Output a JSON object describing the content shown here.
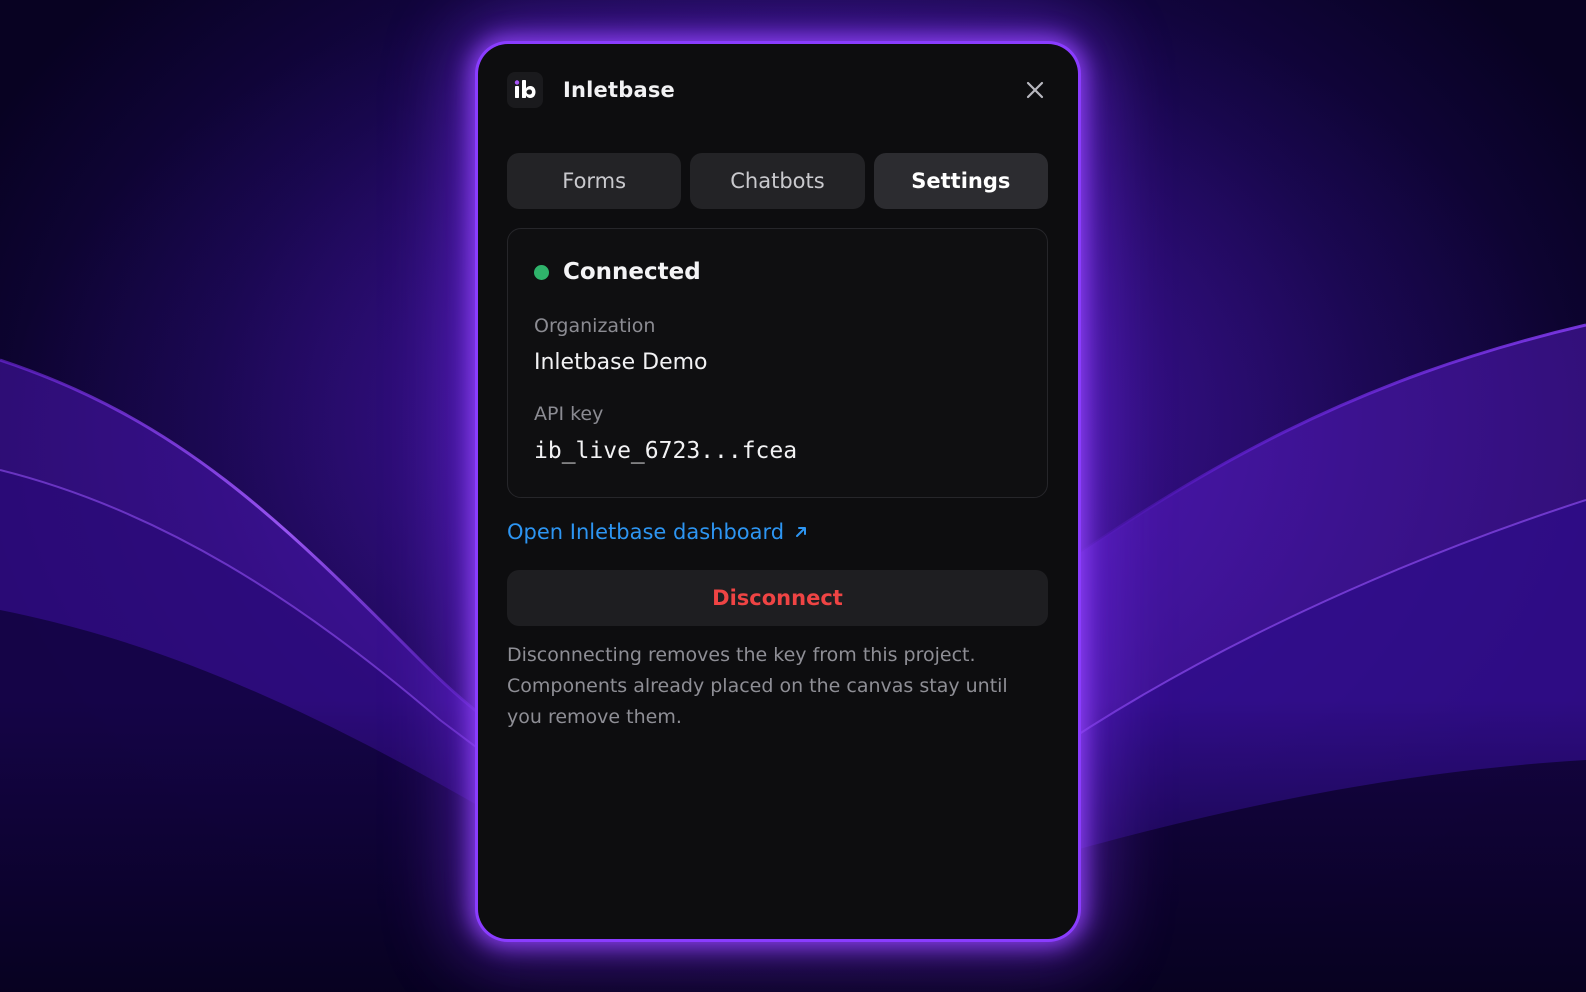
{
  "app": {
    "title": "Inletbase",
    "logo_text": "ib"
  },
  "tabs": [
    {
      "label": "Forms",
      "active": false
    },
    {
      "label": "Chatbots",
      "active": false
    },
    {
      "label": "Settings",
      "active": true
    }
  ],
  "connection": {
    "status": "Connected",
    "status_color": "#2fb36b",
    "organization_label": "Organization",
    "organization_value": "Inletbase Demo",
    "api_key_label": "API key",
    "api_key_value": "ib_live_6723...fcea"
  },
  "dashboard_link": {
    "label": "Open Inletbase dashboard",
    "icon": "external-link-arrow-icon",
    "color": "#2d95f2"
  },
  "disconnect": {
    "label": "Disconnect",
    "color": "#ef4444"
  },
  "note": "Disconnecting removes the key from this project. Components already placed on the canvas stay until you remove them.",
  "theme": {
    "accent": "#8a3cff",
    "panel_bg": "#0d0d0f"
  }
}
